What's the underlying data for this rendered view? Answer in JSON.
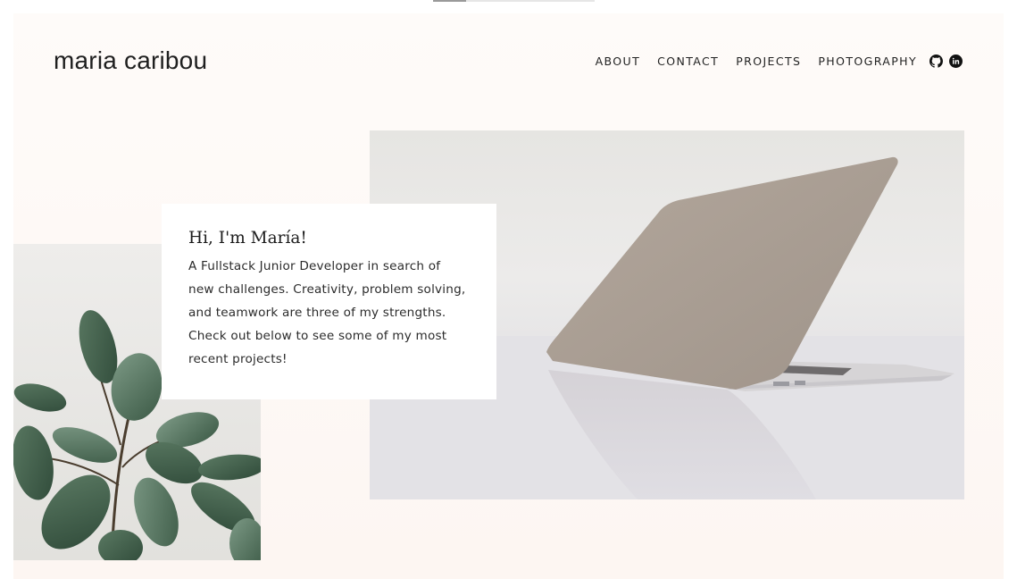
{
  "site": {
    "logo": "maria caribou"
  },
  "nav": {
    "items": [
      {
        "label": "ABOUT"
      },
      {
        "label": "CONTACT"
      },
      {
        "label": "PROJECTS"
      },
      {
        "label": "PHOTOGRAPHY"
      }
    ],
    "social_icons": [
      "github-icon",
      "linkedin-icon"
    ]
  },
  "hero": {
    "heading": "Hi, I'm María!",
    "body": "A Fullstack Junior Developer in search of new challenges. Creativity, problem solving, and teamwork are three of my strengths. Check out below to see some of my most recent projects!",
    "images": {
      "left": "plant-photo",
      "right": "laptop-photo"
    }
  },
  "colors": {
    "page_background": "#fdf8f5",
    "text": "#1f1f1f",
    "card_background": "#ffffff"
  }
}
